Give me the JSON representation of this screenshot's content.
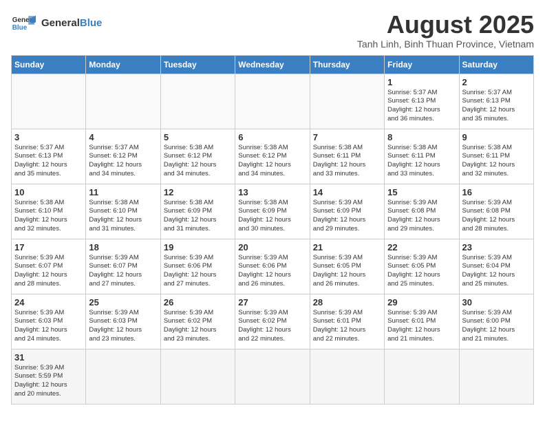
{
  "header": {
    "logo_general": "General",
    "logo_blue": "Blue",
    "title": "August 2025",
    "subtitle": "Tanh Linh, Binh Thuan Province, Vietnam"
  },
  "days_of_week": [
    "Sunday",
    "Monday",
    "Tuesday",
    "Wednesday",
    "Thursday",
    "Friday",
    "Saturday"
  ],
  "weeks": [
    [
      {
        "date": "",
        "info": ""
      },
      {
        "date": "",
        "info": ""
      },
      {
        "date": "",
        "info": ""
      },
      {
        "date": "",
        "info": ""
      },
      {
        "date": "",
        "info": ""
      },
      {
        "date": "1",
        "info": "Sunrise: 5:37 AM\nSunset: 6:13 PM\nDaylight: 12 hours\nand 36 minutes."
      },
      {
        "date": "2",
        "info": "Sunrise: 5:37 AM\nSunset: 6:13 PM\nDaylight: 12 hours\nand 35 minutes."
      }
    ],
    [
      {
        "date": "3",
        "info": "Sunrise: 5:37 AM\nSunset: 6:13 PM\nDaylight: 12 hours\nand 35 minutes."
      },
      {
        "date": "4",
        "info": "Sunrise: 5:37 AM\nSunset: 6:12 PM\nDaylight: 12 hours\nand 34 minutes."
      },
      {
        "date": "5",
        "info": "Sunrise: 5:38 AM\nSunset: 6:12 PM\nDaylight: 12 hours\nand 34 minutes."
      },
      {
        "date": "6",
        "info": "Sunrise: 5:38 AM\nSunset: 6:12 PM\nDaylight: 12 hours\nand 34 minutes."
      },
      {
        "date": "7",
        "info": "Sunrise: 5:38 AM\nSunset: 6:11 PM\nDaylight: 12 hours\nand 33 minutes."
      },
      {
        "date": "8",
        "info": "Sunrise: 5:38 AM\nSunset: 6:11 PM\nDaylight: 12 hours\nand 33 minutes."
      },
      {
        "date": "9",
        "info": "Sunrise: 5:38 AM\nSunset: 6:11 PM\nDaylight: 12 hours\nand 32 minutes."
      }
    ],
    [
      {
        "date": "10",
        "info": "Sunrise: 5:38 AM\nSunset: 6:10 PM\nDaylight: 12 hours\nand 32 minutes."
      },
      {
        "date": "11",
        "info": "Sunrise: 5:38 AM\nSunset: 6:10 PM\nDaylight: 12 hours\nand 31 minutes."
      },
      {
        "date": "12",
        "info": "Sunrise: 5:38 AM\nSunset: 6:09 PM\nDaylight: 12 hours\nand 31 minutes."
      },
      {
        "date": "13",
        "info": "Sunrise: 5:38 AM\nSunset: 6:09 PM\nDaylight: 12 hours\nand 30 minutes."
      },
      {
        "date": "14",
        "info": "Sunrise: 5:39 AM\nSunset: 6:09 PM\nDaylight: 12 hours\nand 29 minutes."
      },
      {
        "date": "15",
        "info": "Sunrise: 5:39 AM\nSunset: 6:08 PM\nDaylight: 12 hours\nand 29 minutes."
      },
      {
        "date": "16",
        "info": "Sunrise: 5:39 AM\nSunset: 6:08 PM\nDaylight: 12 hours\nand 28 minutes."
      }
    ],
    [
      {
        "date": "17",
        "info": "Sunrise: 5:39 AM\nSunset: 6:07 PM\nDaylight: 12 hours\nand 28 minutes."
      },
      {
        "date": "18",
        "info": "Sunrise: 5:39 AM\nSunset: 6:07 PM\nDaylight: 12 hours\nand 27 minutes."
      },
      {
        "date": "19",
        "info": "Sunrise: 5:39 AM\nSunset: 6:06 PM\nDaylight: 12 hours\nand 27 minutes."
      },
      {
        "date": "20",
        "info": "Sunrise: 5:39 AM\nSunset: 6:06 PM\nDaylight: 12 hours\nand 26 minutes."
      },
      {
        "date": "21",
        "info": "Sunrise: 5:39 AM\nSunset: 6:05 PM\nDaylight: 12 hours\nand 26 minutes."
      },
      {
        "date": "22",
        "info": "Sunrise: 5:39 AM\nSunset: 6:05 PM\nDaylight: 12 hours\nand 25 minutes."
      },
      {
        "date": "23",
        "info": "Sunrise: 5:39 AM\nSunset: 6:04 PM\nDaylight: 12 hours\nand 25 minutes."
      }
    ],
    [
      {
        "date": "24",
        "info": "Sunrise: 5:39 AM\nSunset: 6:03 PM\nDaylight: 12 hours\nand 24 minutes."
      },
      {
        "date": "25",
        "info": "Sunrise: 5:39 AM\nSunset: 6:03 PM\nDaylight: 12 hours\nand 23 minutes."
      },
      {
        "date": "26",
        "info": "Sunrise: 5:39 AM\nSunset: 6:02 PM\nDaylight: 12 hours\nand 23 minutes."
      },
      {
        "date": "27",
        "info": "Sunrise: 5:39 AM\nSunset: 6:02 PM\nDaylight: 12 hours\nand 22 minutes."
      },
      {
        "date": "28",
        "info": "Sunrise: 5:39 AM\nSunset: 6:01 PM\nDaylight: 12 hours\nand 22 minutes."
      },
      {
        "date": "29",
        "info": "Sunrise: 5:39 AM\nSunset: 6:01 PM\nDaylight: 12 hours\nand 21 minutes."
      },
      {
        "date": "30",
        "info": "Sunrise: 5:39 AM\nSunset: 6:00 PM\nDaylight: 12 hours\nand 21 minutes."
      }
    ],
    [
      {
        "date": "31",
        "info": "Sunrise: 5:39 AM\nSunset: 5:59 PM\nDaylight: 12 hours\nand 20 minutes."
      },
      {
        "date": "",
        "info": ""
      },
      {
        "date": "",
        "info": ""
      },
      {
        "date": "",
        "info": ""
      },
      {
        "date": "",
        "info": ""
      },
      {
        "date": "",
        "info": ""
      },
      {
        "date": "",
        "info": ""
      }
    ]
  ]
}
